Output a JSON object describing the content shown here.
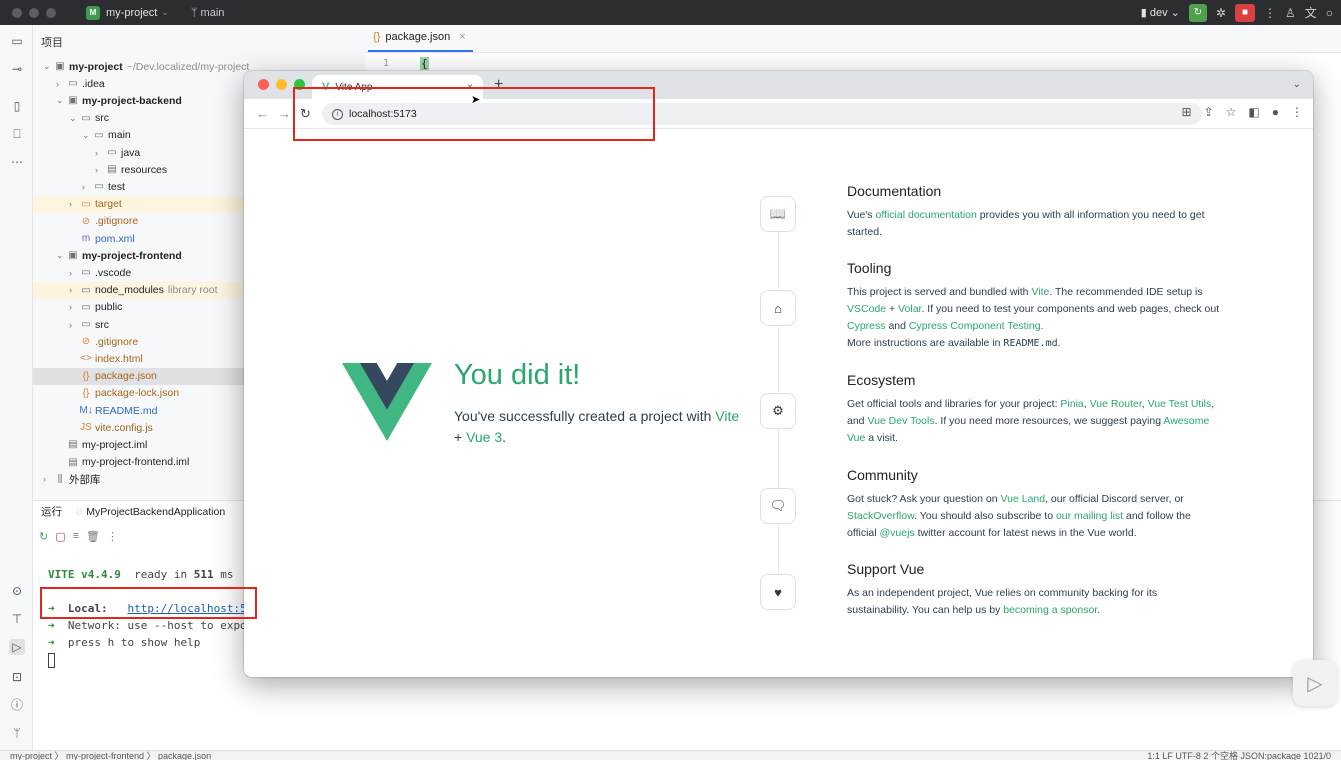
{
  "ide": {
    "project_name": "my-project",
    "branch": "main",
    "run_config": "dev",
    "panel_title": "项目",
    "project_path": "~/Dev.localized/my-project",
    "tree": [
      {
        "label": "my-project",
        "hint": "~/Dev.localized/my-project",
        "indent": 0,
        "chev": "⌄",
        "icon": "folder-module-icon",
        "bold": true
      },
      {
        "label": ".idea",
        "indent": 1,
        "chev": "›",
        "icon": "folder-icon"
      },
      {
        "label": "my-project-backend",
        "indent": 1,
        "chev": "⌄",
        "icon": "folder-module-icon",
        "bold": true
      },
      {
        "label": "src",
        "indent": 2,
        "chev": "⌄",
        "icon": "folder-icon"
      },
      {
        "label": "main",
        "indent": 3,
        "chev": "⌄",
        "icon": "folder-icon"
      },
      {
        "label": "java",
        "indent": 4,
        "chev": "›",
        "icon": "folder-icon"
      },
      {
        "label": "resources",
        "indent": 4,
        "chev": "›",
        "icon": "folder-resources-icon"
      },
      {
        "label": "test",
        "indent": 3,
        "chev": "›",
        "icon": "folder-icon"
      },
      {
        "label": "target",
        "indent": 2,
        "chev": "›",
        "icon": "folder-icon",
        "highlight": "target",
        "color": "orange"
      },
      {
        "label": ".gitignore",
        "indent": 2,
        "chev": "",
        "icon": "gitignore-icon",
        "color": "orange"
      },
      {
        "label": "pom.xml",
        "indent": 2,
        "chev": "",
        "icon": "maven-icon",
        "color": "blue"
      },
      {
        "label": "my-project-frontend",
        "indent": 1,
        "chev": "⌄",
        "icon": "folder-module-icon",
        "bold": true
      },
      {
        "label": ".vscode",
        "indent": 2,
        "chev": "›",
        "icon": "folder-icon"
      },
      {
        "label": "node_modules",
        "hint": "library root",
        "indent": 2,
        "chev": "›",
        "icon": "folder-icon",
        "highlight": "target"
      },
      {
        "label": "public",
        "indent": 2,
        "chev": "›",
        "icon": "folder-icon"
      },
      {
        "label": "src",
        "indent": 2,
        "chev": "›",
        "icon": "folder-icon"
      },
      {
        "label": ".gitignore",
        "indent": 2,
        "chev": "",
        "icon": "gitignore-icon",
        "color": "orange"
      },
      {
        "label": "index.html",
        "indent": 2,
        "chev": "",
        "icon": "html-icon",
        "color": "orange"
      },
      {
        "label": "package.json",
        "indent": 2,
        "chev": "",
        "icon": "json-icon",
        "color": "orange",
        "highlight": "selected"
      },
      {
        "label": "package-lock.json",
        "indent": 2,
        "chev": "",
        "icon": "json-icon",
        "color": "orange"
      },
      {
        "label": "README.md",
        "indent": 2,
        "chev": "",
        "icon": "markdown-icon",
        "color": "blue"
      },
      {
        "label": "vite.config.js",
        "indent": 2,
        "chev": "",
        "icon": "js-icon",
        "color": "orange"
      },
      {
        "label": "my-project.iml",
        "indent": 1,
        "chev": "",
        "icon": "iml-icon"
      },
      {
        "label": "my-project-frontend.iml",
        "indent": 1,
        "chev": "",
        "icon": "iml-icon"
      },
      {
        "label": "外部库",
        "indent": 0,
        "chev": "›",
        "icon": "library-icon"
      }
    ],
    "editor_tab": "package.json",
    "line_number": "1",
    "code_line": "{",
    "run": {
      "tab_label": "运行",
      "config_name": "MyProjectBackendApplication",
      "console": {
        "vite": "VITE v4.4.9",
        "ready": "ready in",
        "ms_value": "511",
        "ms_unit": "ms",
        "local_label": "Local:",
        "local_url": "http://localhost:5",
        "network_line": "Network: use --host to expo",
        "help_line": "press h to show help"
      }
    },
    "status": {
      "crumbs": "my-project 〉 my-project-frontend 〉 package.json",
      "right": "1:1   LF   UTF-8   2 个空格   JSON:package   1021/0"
    }
  },
  "browser": {
    "tab_title": "Vite App",
    "url": "localhost:5173",
    "hero": {
      "title": "You did it!",
      "sub_prefix": "You've successfully created a project with",
      "link1": "Vite",
      "plus": "+",
      "link2": "Vue 3",
      "period": "."
    },
    "sections": [
      {
        "title": "Documentation",
        "icon": "book-icon"
      },
      {
        "title": "Tooling",
        "icon": "toolbox-icon"
      },
      {
        "title": "Ecosystem",
        "icon": "ecosystem-icon"
      },
      {
        "title": "Community",
        "icon": "chat-icon"
      },
      {
        "title": "Support Vue",
        "icon": "heart-icon"
      }
    ],
    "doc": {
      "t1": "Vue's",
      "l1": "official documentation",
      "t2": "provides you with all information you need to get started."
    },
    "tooling": {
      "t1": "This project is served and bundled with",
      "l1": "Vite",
      "t2": ". The recommended IDE setup is",
      "l2": "VSCode",
      "t3": "+",
      "l3": "Volar",
      "t4": ". If you need to test your components and web pages, check out",
      "l4": "Cypress",
      "t5": "and",
      "l5": "Cypress Component Testing",
      "t6": ".",
      "t7": "More instructions are available in",
      "code": "README.md",
      "t8": "."
    },
    "ecosystem": {
      "t1": "Get official tools and libraries for your project:",
      "l1": "Pinia",
      "c1": ",",
      "l2": "Vue Router",
      "c2": ",",
      "l3": "Vue Test Utils",
      "t2": ", and",
      "l4": "Vue Dev Tools",
      "t3": ". If you need more resources, we suggest paying",
      "l5": "Awesome Vue",
      "t4": "a visit."
    },
    "community": {
      "t1": "Got stuck? Ask your question on",
      "l1": "Vue Land",
      "t2": ", our official Discord server, or",
      "l2": "StackOverflow",
      "t3": ". You should also subscribe to",
      "l3": "our mailing list",
      "t4": "and follow the official",
      "l4": "@vuejs",
      "t5": "twitter account for latest news in the Vue world."
    },
    "support": {
      "t1": "As an independent project, Vue relies on community backing for its sustainability. You can help us by",
      "l1": "becoming a sponsor",
      "t2": "."
    }
  },
  "colors": {
    "vue_green": "#2aa670",
    "annotation_red": "#e2261c",
    "ide_dark": "#2b2d30"
  }
}
